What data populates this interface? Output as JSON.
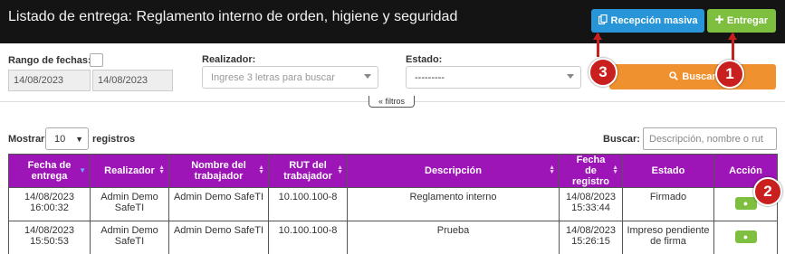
{
  "header": {
    "title": "Listado de entrega: Reglamento interno de orden, higiene y seguridad",
    "masiva_label": "Recepción masiva",
    "masiva_icon": "copy-icon",
    "entregar_label": "Entregar",
    "entregar_icon": "plus-icon"
  },
  "filters": {
    "rango_label": "Rango de fechas:",
    "date_from": "14/08/2023",
    "date_to": "14/08/2023",
    "realizador_label": "Realizador:",
    "realizador_placeholder": "Ingrese 3 letras para buscar",
    "estado_label": "Estado:",
    "estado_value": "---------",
    "buscar_label": "Buscar",
    "buscar_icon": "search-icon",
    "filtros_toggle": "filtros"
  },
  "table_controls": {
    "mostrar_label": "Mostrar",
    "page_length": "10",
    "registros_label": "registros",
    "search_label": "Buscar:",
    "search_placeholder": "Descripción, nombre o rut"
  },
  "table": {
    "columns": [
      "Fecha de entrega",
      "Realizador",
      "Nombre del trabajador",
      "RUT del trabajador",
      "Descripción",
      "Fecha de registro",
      "Estado",
      "Acción"
    ],
    "rows": [
      {
        "fecha_entrega": "14/08/2023 16:00:32",
        "realizador": "Admin Demo SafeTI",
        "nombre": "Admin Demo SafeTI",
        "rut": "10.100.100-8",
        "descripcion": "Reglamento interno",
        "fecha_registro": "14/08/2023 15:33:44",
        "estado": "Firmado"
      },
      {
        "fecha_entrega": "14/08/2023 15:50:53",
        "realizador": "Admin Demo SafeTI",
        "nombre": "Admin Demo SafeTI",
        "rut": "10.100.100-8",
        "descripcion": "Prueba",
        "fecha_registro": "14/08/2023 15:26:15",
        "estado": "Impreso pendiente de firma"
      }
    ]
  },
  "annotations": {
    "marker1": "1",
    "marker2": "2",
    "marker3": "3"
  },
  "colors": {
    "header_bg": "#141414",
    "table_header": "#9d14b7",
    "masiva_button": "#2795d8",
    "entregar_button": "#7fbf3f",
    "buscar_button": "#f0912f",
    "marker": "#c9201f"
  }
}
